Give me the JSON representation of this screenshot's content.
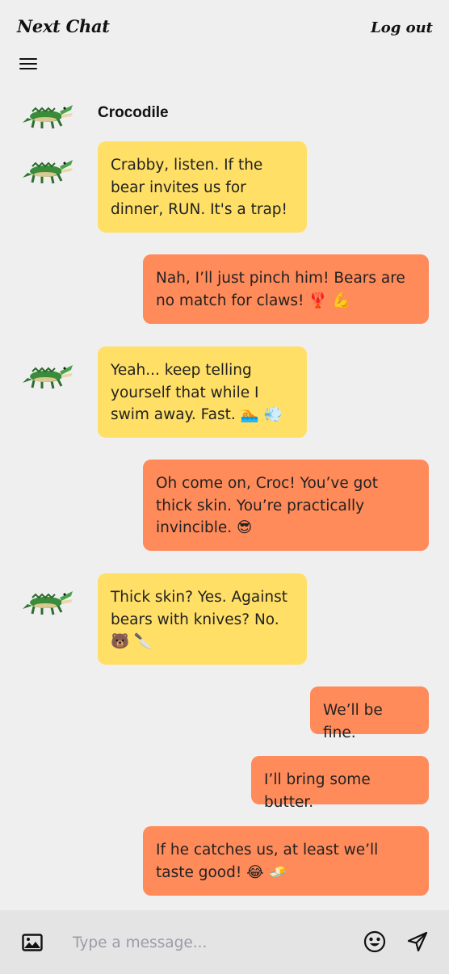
{
  "app": {
    "title": "Next Chat",
    "logout_label": "Log out"
  },
  "contact": {
    "name": "Crocodile"
  },
  "messages": [
    {
      "from": "them",
      "text": "Crabby, listen. If the bear invites us for dinner, RUN. It's a trap!"
    },
    {
      "from": "me",
      "text": "Nah, I’ll just pinch him! Bears are no match for claws! 🦞 💪"
    },
    {
      "from": "them",
      "text": "Yeah... keep telling yourself that while I swim away. Fast. 🏊 💨"
    },
    {
      "from": "me",
      "text": "Oh come on, Croc! You’ve got thick skin. You’re practically invincible. 😎"
    },
    {
      "from": "them",
      "text": "Thick skin? Yes. Against bears with knives? No. 🐻 🔪"
    },
    {
      "from": "me",
      "text": "We’ll be fine."
    },
    {
      "from": "me",
      "text": "I’ll bring some butter."
    },
    {
      "from": "me",
      "text": "If he catches us, at least we’ll taste good! 😂 🧈"
    }
  ],
  "composer": {
    "placeholder": "Type a message..."
  },
  "icons": {
    "menu": "hamburger-icon",
    "image": "image-icon",
    "emoji": "smiley-icon",
    "send": "send-icon"
  }
}
